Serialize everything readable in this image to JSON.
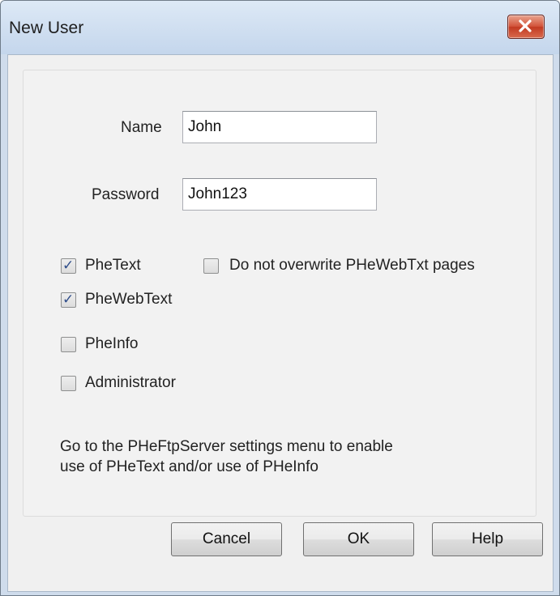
{
  "window": {
    "title": "New User",
    "close_glyph": "✕",
    "close_icon": "close-icon"
  },
  "form": {
    "name_label": "Name",
    "name_value": "John",
    "password_label": "Password",
    "password_value": "John123"
  },
  "options": {
    "phetext": {
      "label": "PheText",
      "checked": true
    },
    "do_not_overwrite": {
      "label": "Do not overwrite PHeWebTxt pages",
      "checked": false
    },
    "phewebtext": {
      "label": "PheWebText",
      "checked": true
    },
    "pheinfo": {
      "label": "PheInfo",
      "checked": false
    },
    "administrator": {
      "label": "Administrator",
      "checked": false
    }
  },
  "note": {
    "line1": "Go to the PHeFtpServer settings menu to enable",
    "line2": "use of PHeText and/or use of PHeInfo"
  },
  "buttons": {
    "cancel": "Cancel",
    "ok": "OK",
    "help": "Help"
  },
  "check_glyph": "✓"
}
